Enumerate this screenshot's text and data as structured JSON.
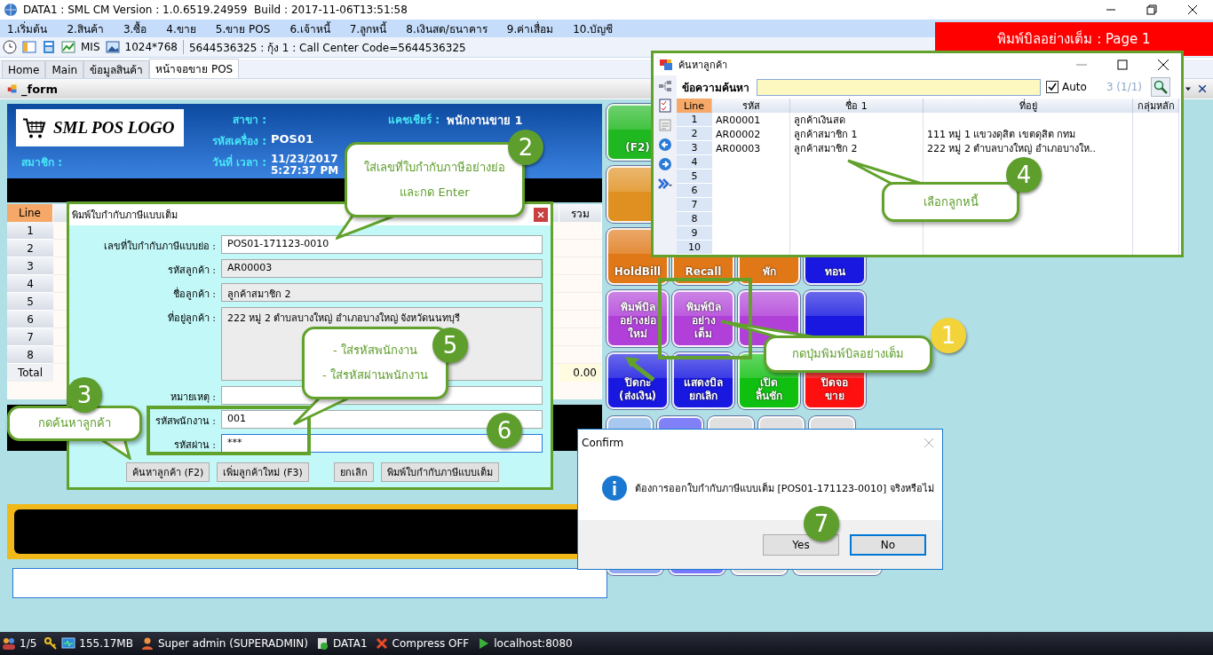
{
  "window": {
    "title": "DATA1 : SML CM Version : 1.0.6519.24959  Build : 2017-11-06T13:51:58"
  },
  "menu": [
    "1.เริ่มต้น",
    "2.สินค้า",
    "3.ซื้อ",
    "4.ขาย",
    "5.ขาย POS",
    "6.เจ้าหนี้",
    "7.ลูกหนี้",
    "8.เงินสด/ธนาคาร",
    "9.ค่าเสื่อม",
    "10.บัญชี"
  ],
  "toolbar": {
    "mis": "MIS",
    "resolution": "1024*768",
    "info": "5644536325 : กุ้ง 1 : Call Center Code=5644536325"
  },
  "tabs": [
    {
      "label": "Home",
      "selected": false
    },
    {
      "label": "Main",
      "selected": false
    },
    {
      "label": "ข้อมูลสินค้า",
      "selected": false
    },
    {
      "label": "หน้าจอขาย POS",
      "selected": true
    }
  ],
  "form_title": "_form",
  "banner": "พิมพ์บิลอย่างเต็ม : Page 1",
  "pos_header": {
    "logo": "SML POS LOGO",
    "member_label": "สมาชิก :",
    "branch_label": "สาขา :",
    "machine_label": "รหัสเครื่อง :",
    "machine": "POS01",
    "datetime_label": "วันที่ เวลา :",
    "date": "11/23/2017",
    "time": "5:27:37 PM",
    "cashier_label": "แคชเชียร์ :",
    "cashier": "พนักงานขาย 1"
  },
  "pos_table": {
    "line_header": "Line",
    "amount_header": "รวม",
    "rows": [
      "1",
      "2",
      "3",
      "4",
      "5",
      "6",
      "7",
      "8"
    ],
    "total_label": "Total",
    "total": "0.00"
  },
  "pos_buttons": [
    {
      "color": "#20b820",
      "lines": [
        "(F2)"
      ]
    },
    {
      "color": "#e09020"
    },
    {
      "color": "#e07818",
      "lines": [
        "HoldBill"
      ]
    },
    {
      "color": "#e07818",
      "lines": [
        "Recall"
      ]
    },
    {
      "color": "#e07818",
      "lines": [
        "พัก"
      ]
    },
    {
      "color": "#1818e0",
      "lines": [
        "ทอน"
      ]
    },
    {
      "color": "#b040d8",
      "lines": [
        "พิมพ์บิล",
        "อย่างย่อ",
        "ใหม่"
      ]
    },
    {
      "color": "#b040d8",
      "lines": [
        "พิมพ์บิล",
        "อย่าง",
        "เต็ม"
      ]
    },
    {
      "color": "#b040d8"
    },
    {
      "color": "#1818e0"
    },
    {
      "color": "#1818e0",
      "lines": [
        "ปิดกะ",
        "(ส่งเงิน)"
      ]
    },
    {
      "color": "#1818e0",
      "lines": [
        "แสดงบิล",
        "ยกเลิก"
      ]
    },
    {
      "color": "#10c010",
      "lines": [
        "เปิด",
        "ลิ้นชัก"
      ]
    },
    {
      "color": "#ff1010",
      "lines": [
        "ปิดจอ",
        "ขาย"
      ]
    }
  ],
  "lower_buttons": [
    {
      "color": "#a8c8f0"
    },
    {
      "color": "#8080f8"
    },
    {
      "color": "#e0e0e0"
    },
    {
      "color": "#e0e0e0"
    },
    {
      "color": "#e0e0e0"
    }
  ],
  "bottom_buttons": [
    {
      "color": "#90a8f0"
    },
    {
      "color": "#7878ff"
    },
    {
      "color": "#e0e0e0"
    },
    {
      "color": "#e0e0e0"
    }
  ],
  "tax_dialog": {
    "title": "พิมพ์ใบกำกับภาษีแบบเต็ม",
    "fields": [
      {
        "label": "เลขที่ใบกำกับภาษีแบบย่อ :",
        "value": "POS01-171123-0010",
        "kind": "input"
      },
      {
        "label": "รหัสลูกค้า :",
        "value": "AR00003",
        "kind": "readonly"
      },
      {
        "label": "ชื่อลูกค้า :",
        "value": "ลูกค้าสมาชิก 2",
        "kind": "readonly"
      },
      {
        "label": "ที่อยู่ลูกค้า :",
        "value": "222 หมู่ 2 ตำบลบางใหญ่ อำเภอบางใหญ่ จังหวัดนนทบุรี",
        "kind": "area"
      },
      {
        "label": "หมายเหตุ :",
        "kind": "input"
      },
      {
        "label": "รหัสพนักงาน :",
        "value": "001",
        "kind": "input"
      },
      {
        "label": "รหัสผ่าน :",
        "value": "***",
        "kind": "focused"
      }
    ],
    "buttons": [
      "ค้นหาลูกค้า (F2)",
      "เพิ่มลูกค้าใหม่ (F3)",
      "ยกเลิก",
      "พิมพ์ใบกำกับภาษีแบบเต็ม"
    ]
  },
  "search_window": {
    "title": "ค้นหาลูกค้า",
    "search_label": "ข้อความค้นหา",
    "auto": {
      "label": "Auto",
      "checked": true
    },
    "count": "3 (1/1)",
    "columns": [
      "Line",
      "รหัส",
      "ชื่อ 1",
      "ที่อยู่",
      "กลุ่มหลัก"
    ],
    "rows": [
      {
        "line": "1",
        "code": "AR00001",
        "name": "ลูกค้าเงินสด"
      },
      {
        "line": "2",
        "code": "AR00002",
        "name": "ลูกค้าสมาชิก 1",
        "address": "111 หมู่ 1 แขวงดุสิต เขตดุสิต กทม"
      },
      {
        "line": "3",
        "code": "AR00003",
        "name": "ลูกค้าสมาชิก 2",
        "address": "222 หมู่ 2 ตำบลบางใหญ่ อำเภอบางให.."
      },
      {
        "line": "4"
      },
      {
        "line": "5"
      },
      {
        "line": "6"
      },
      {
        "line": "7"
      },
      {
        "line": "8"
      },
      {
        "line": "9"
      },
      {
        "line": "10"
      }
    ]
  },
  "confirm": {
    "title": "Confirm",
    "message": "ต้องการออกใบกำกับภาษีแบบเต็ม [POS01-171123-0010] จริงหรือไม่",
    "buttons": [
      "Yes",
      "No"
    ]
  },
  "steps": [
    {
      "number": "1",
      "color": "#f2d43a",
      "lines": [
        "กดปุ่มพิมพ์บิลอย่างเต็ม"
      ]
    },
    {
      "number": "2",
      "color": "#5e9e2c",
      "lines": [
        "ใส่เลขที่ใบกำกับภาษีอย่างย่อ",
        "และกด Enter"
      ]
    },
    {
      "number": "3",
      "color": "#5e9e2c",
      "lines": [
        "กดค้นหาลูกค้า"
      ]
    },
    {
      "number": "4",
      "color": "#5e9e2c",
      "lines": [
        "เลือกลูกหนี้"
      ]
    },
    {
      "number": "5",
      "color": "#5e9e2c",
      "lines": [
        "- ใส่รหัสพนักงาน",
        "- ใส่รหัสผ่านพนักงาน"
      ]
    },
    {
      "number": "6",
      "color": "#5e9e2c"
    },
    {
      "number": "7",
      "color": "#5e9e2c"
    }
  ],
  "status_bar": {
    "sessions": "1/5",
    "memory": "155.17MB",
    "user": "Super admin (SUPERADMIN)",
    "database": "DATA1",
    "compress": "Compress OFF",
    "server": "localhost:8080"
  }
}
